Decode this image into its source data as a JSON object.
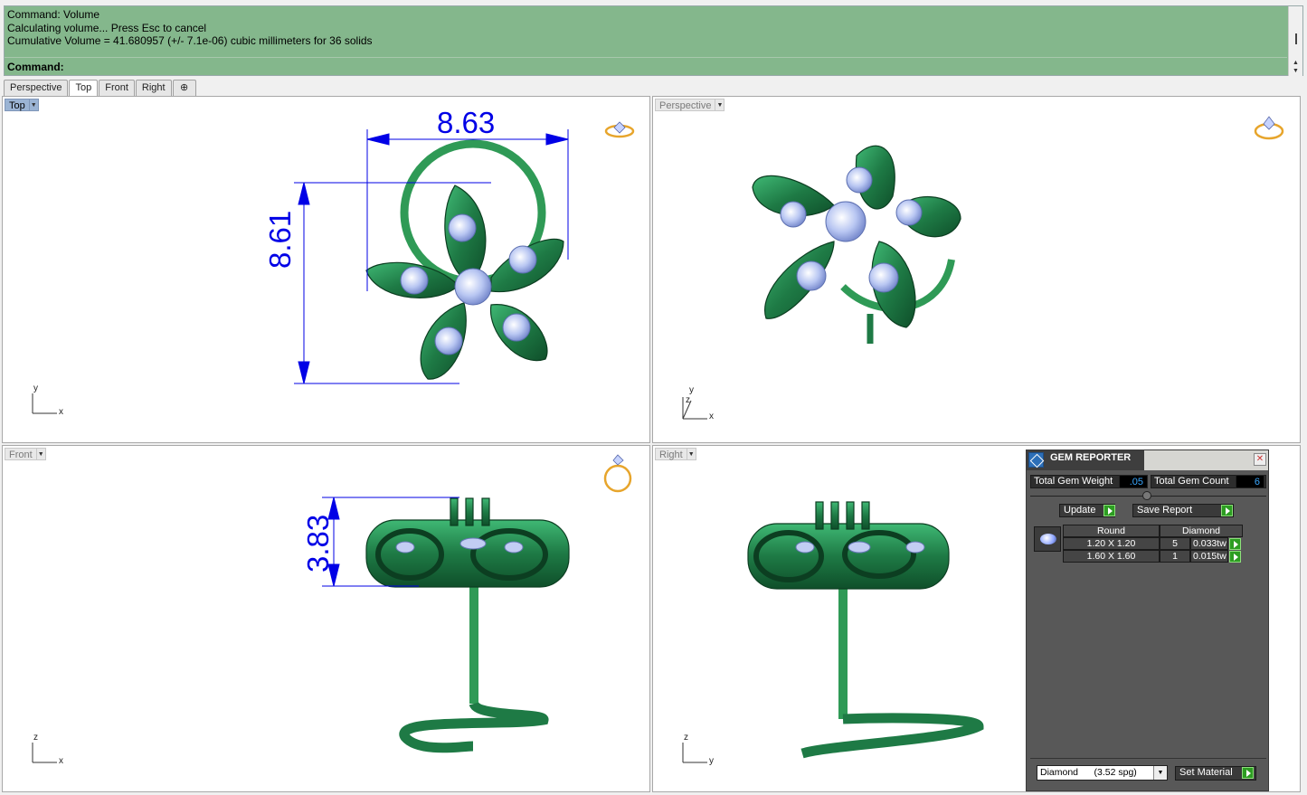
{
  "command": {
    "history": [
      "Command: Volume",
      "Calculating volume... Press Esc to cancel",
      "Cumulative Volume = 41.680957 (+/- 7.1e-06) cubic millimeters for 36 solids"
    ],
    "prompt": "Command:"
  },
  "tabs": [
    {
      "label": "Perspective",
      "active": false
    },
    {
      "label": "Top",
      "active": true
    },
    {
      "label": "Front",
      "active": false
    },
    {
      "label": "Right",
      "active": false
    }
  ],
  "tab_add_glyph": "⊕",
  "viewports": {
    "top": {
      "label": "Top",
      "axis_v": "y",
      "axis_h": "x",
      "dim_width": "8.63",
      "dim_height": "8.61"
    },
    "perspective": {
      "label": "Perspective",
      "axis_v": "z",
      "axis_y": "y",
      "axis_h": "x"
    },
    "front": {
      "label": "Front",
      "axis_v": "z",
      "axis_h": "x",
      "dim_height": "3.83"
    },
    "right": {
      "label": "Right",
      "axis_v": "z",
      "axis_h": "y"
    }
  },
  "dropdown_glyph": "▼",
  "gem_reporter": {
    "title": "GEM REPORTER",
    "close_glyph": "✕",
    "total_weight_label": "Total Gem Weight",
    "total_weight_value": ".05",
    "total_count_label": "Total Gem Count",
    "total_count_value": "6",
    "update_label": "Update",
    "save_report_label": "Save Report",
    "table_headers": [
      "Round",
      "Diamond"
    ],
    "rows": [
      {
        "size": "1.20 X 1.20",
        "count": "5",
        "weight": "0.033tw"
      },
      {
        "size": "1.60 X 1.60",
        "count": "1",
        "weight": "0.015tw"
      }
    ],
    "material_select": "Diamond      (3.52 spg)",
    "set_material_label": "Set Material"
  },
  "colors": {
    "command_bg": "#84b78c",
    "model_green": "#1e7a45",
    "dimension_blue": "#0000e6",
    "gem_panel_bg": "#585858"
  }
}
